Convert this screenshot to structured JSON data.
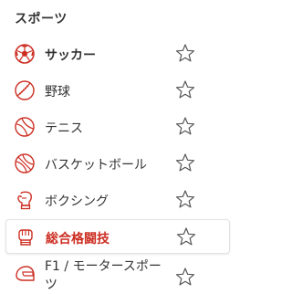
{
  "section": {
    "title": "スポーツ"
  },
  "sports": [
    {
      "label": "サッカー",
      "icon": "soccer-ball-icon"
    },
    {
      "label": "野球",
      "icon": "baseball-icon"
    },
    {
      "label": "テニス",
      "icon": "tennis-ball-icon"
    },
    {
      "label": "バスケットボール",
      "icon": "basketball-icon"
    },
    {
      "label": "ボクシング",
      "icon": "boxing-glove-icon"
    },
    {
      "label": "総合格闘技",
      "icon": "mma-glove-icon",
      "selected": true
    },
    {
      "label": "F1 / モータースポーツ",
      "icon": "racing-helmet-icon"
    }
  ],
  "colors": {
    "accent": "#cc2e22",
    "text": "#333333"
  },
  "star_icon": "star-outline-icon"
}
